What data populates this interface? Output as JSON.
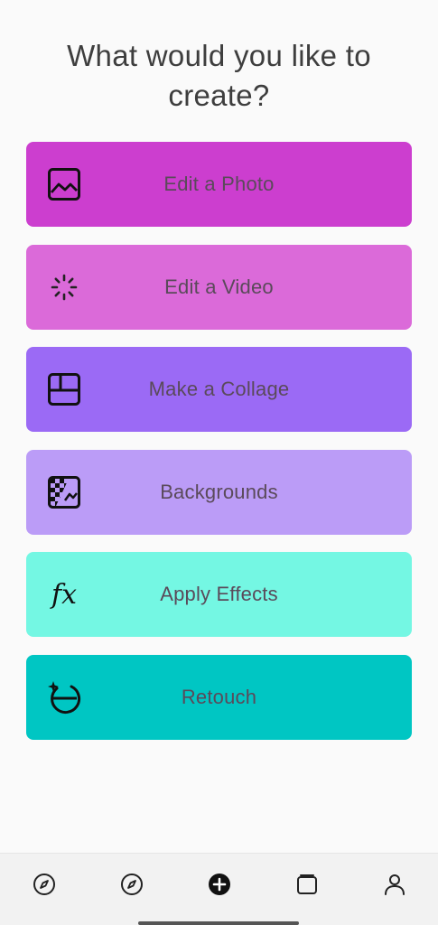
{
  "header": {
    "title": "What would you like to create?"
  },
  "options": [
    {
      "label": "Edit a Photo",
      "icon": "photo-icon",
      "color": "#cc3ecf"
    },
    {
      "label": "Edit a Video",
      "icon": "loading-spinner-icon",
      "color": "#db6ad9"
    },
    {
      "label": "Make a Collage",
      "icon": "collage-layout-icon",
      "color": "#9b6af5"
    },
    {
      "label": "Backgrounds",
      "icon": "background-checker-icon",
      "color": "#bb9cf7"
    },
    {
      "label": "Apply Effects",
      "icon": "fx-icon",
      "icon_text": "fx",
      "color": "#74f7e3"
    },
    {
      "label": "Retouch",
      "icon": "retouch-face-icon",
      "color": "#00c6c3"
    }
  ],
  "bottom_nav": {
    "items": [
      {
        "icon": "compass-icon"
      },
      {
        "icon": "explore-compass-icon"
      },
      {
        "icon": "create-plus-icon"
      },
      {
        "icon": "gallery-icon"
      },
      {
        "icon": "profile-icon"
      }
    ]
  }
}
